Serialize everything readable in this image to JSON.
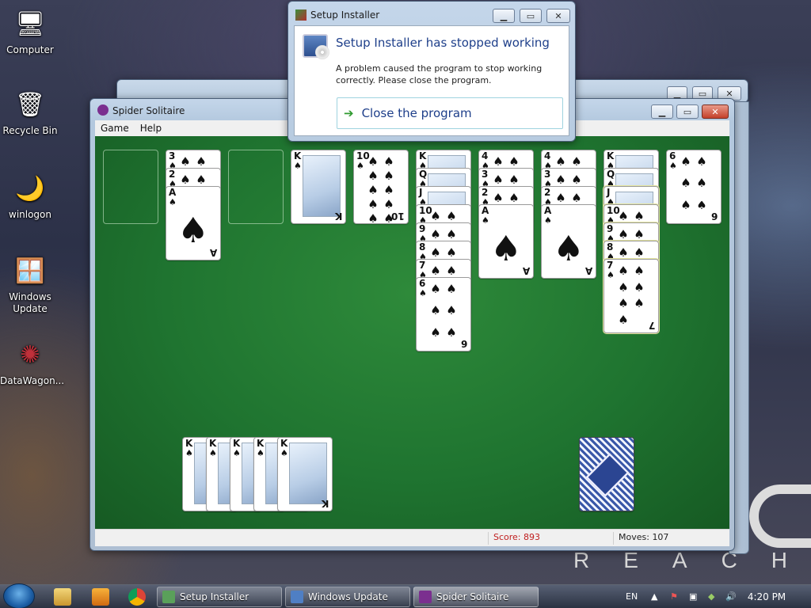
{
  "desktop": {
    "icons": [
      {
        "label": "Computer",
        "icon": "computer-icon",
        "glyph": "🖥"
      },
      {
        "label": "Recycle Bin",
        "icon": "recycle-bin-icon",
        "glyph": "🗑"
      },
      {
        "label": "winlogon",
        "icon": "winlogon-icon",
        "glyph": "🌙"
      },
      {
        "label": "Windows Update",
        "icon": "windows-update-icon",
        "glyph": "🪟"
      },
      {
        "label": "DataWagon...",
        "icon": "datawagon-icon",
        "glyph": "✺"
      }
    ],
    "wallpaper_text": "REACH"
  },
  "setup_dialog": {
    "title": "Setup Installer",
    "heading": "Setup Installer has stopped working",
    "message": "A problem caused the program to stop working correctly. Please close the program.",
    "close_option": "Close the program"
  },
  "spider": {
    "title": "Spider Solitaire",
    "menu": [
      "Game",
      "Help"
    ],
    "score_label": "Score: 893",
    "moves_label": "Moves:",
    "moves_value": "107",
    "suit": "♠"
  },
  "taskbar": {
    "tasks": [
      {
        "label": "Setup Installer",
        "color": "#5aa05a"
      },
      {
        "label": "Windows Update",
        "color": "#4f7fc4"
      },
      {
        "label": "Spider Solitaire",
        "color": "#7b2f8f"
      }
    ],
    "language": "EN",
    "clock": "4:20 PM"
  }
}
